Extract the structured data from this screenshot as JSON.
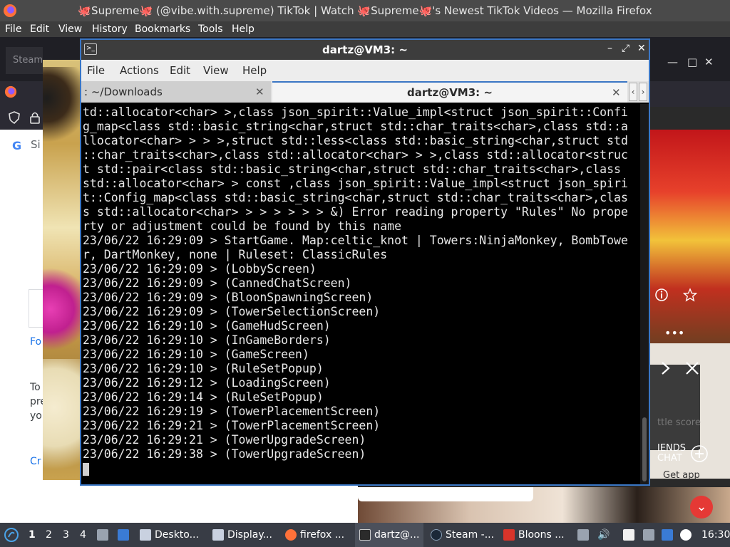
{
  "firefox": {
    "title": "🐙Supreme🐙 (@vibe.with.supreme) TikTok | Watch 🐙Supreme🐙's Newest TikTok Videos — Mozilla Firefox",
    "menu": [
      "File",
      "Edit",
      "View",
      "History",
      "Bookmarks",
      "Tools",
      "Help"
    ],
    "steam_tab": "Steam",
    "window_controls": [
      "—",
      "□",
      "✕"
    ]
  },
  "google_page": {
    "g_logo": "G",
    "sign_text": "Si",
    "snippets": [
      "Fo",
      "To",
      "pre",
      "yo",
      "Cr"
    ]
  },
  "game_right": {
    "labels": [
      "ttle score",
      "IENDS",
      "CHAT",
      "Get app"
    ],
    "icons": [
      "info-icon",
      "star-icon",
      "more-icon",
      "next-icon",
      "close-icon",
      "add-icon"
    ]
  },
  "terminal": {
    "window_title": "dartz@VM3: ~",
    "window_controls": [
      "–",
      "⤢",
      "✕"
    ],
    "menu": [
      "File",
      "Actions",
      "Edit",
      "View",
      "Help"
    ],
    "tabs": [
      {
        "label": ": ~/Downloads",
        "active": false
      },
      {
        "label": "dartz@VM3: ~",
        "active": true
      }
    ],
    "lines": [
      "td::allocator<char> >,class json_spirit::Value_impl<struct json_spirit::Confi",
      "g_map<class std::basic_string<char,struct std::char_traits<char>,class std::a",
      "llocator<char> > > >,struct std::less<class std::basic_string<char,struct std",
      "::char_traits<char>,class std::allocator<char> > >,class std::allocator<struc",
      "t std::pair<class std::basic_string<char,struct std::char_traits<char>,class",
      "std::allocator<char> > const ,class json_spirit::Value_impl<struct json_spiri",
      "t::Config_map<class std::basic_string<char,struct std::char_traits<char>,clas",
      "s std::allocator<char> > > > > > > &) Error reading property \"Rules\" No prope",
      "rty or adjustment could be found by this name",
      "23/06/22 16:29:09 > StartGame. Map:celtic_knot | Towers:NinjaMonkey, BombTowe",
      "r, DartMonkey, none | Ruleset: ClassicRules",
      "23/06/22 16:29:09 > (LobbyScreen)",
      "23/06/22 16:29:09 > (CannedChatScreen)",
      "23/06/22 16:29:09 > (BloonSpawningScreen)",
      "23/06/22 16:29:09 > (TowerSelectionScreen)",
      "23/06/22 16:29:10 > (GameHudScreen)",
      "23/06/22 16:29:10 > (InGameBorders)",
      "23/06/22 16:29:10 > (GameScreen)",
      "23/06/22 16:29:10 > (RuleSetPopup)",
      "23/06/22 16:29:12 > (LoadingScreen)",
      "23/06/22 16:29:14 > (RuleSetPopup)",
      "23/06/22 16:29:19 > (TowerPlacementScreen)",
      "23/06/22 16:29:21 > (TowerPlacementScreen)",
      "23/06/22 16:29:21 > (TowerUpgradeScreen)",
      "23/06/22 16:29:38 > (TowerUpgradeScreen)"
    ]
  },
  "taskbar": {
    "workspaces": [
      "1",
      "2",
      "3",
      "4"
    ],
    "active_workspace": "1",
    "apps": [
      {
        "label": "Deskto...",
        "icon": "desktop-icon",
        "color": "#c9d1e0"
      },
      {
        "label": "Display...",
        "icon": "display-icon",
        "color": "#c9d1e0"
      },
      {
        "label": "firefox ...",
        "icon": "firefox-icon",
        "color": "#ff7139"
      },
      {
        "label": "dartz@...",
        "icon": "terminal-icon",
        "color": "#2b2b2b"
      },
      {
        "label": "Steam -...",
        "icon": "steam-icon",
        "color": "#1b2838"
      },
      {
        "label": "Bloons ...",
        "icon": "bloons-icon",
        "color": "#d8342a"
      }
    ],
    "clock": "16:30"
  }
}
